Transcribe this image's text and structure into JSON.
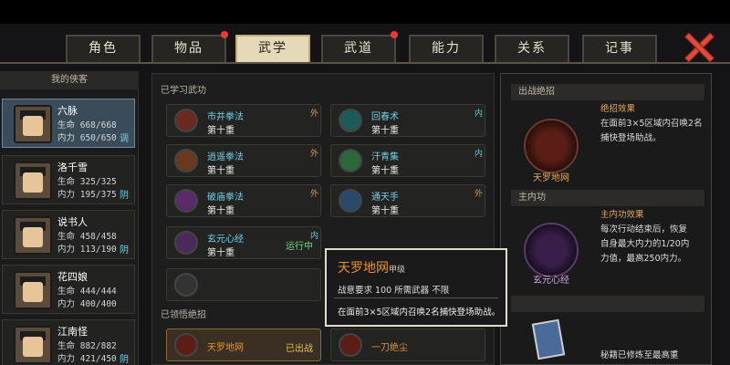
{
  "tabs": [
    {
      "label": "角色",
      "active": false,
      "dot": false
    },
    {
      "label": "物品",
      "active": false,
      "dot": true
    },
    {
      "label": "武学",
      "active": true,
      "dot": false
    },
    {
      "label": "武道",
      "active": false,
      "dot": true
    },
    {
      "label": "能力",
      "active": false,
      "dot": false
    },
    {
      "label": "关系",
      "active": false,
      "dot": false
    },
    {
      "label": "记事",
      "active": false,
      "dot": false
    }
  ],
  "left": {
    "title": "我的侠客",
    "characters": [
      {
        "name": "六脉",
        "hp": "生命 668/668",
        "mp": "内力 650/650",
        "tag": "调",
        "selected": true
      },
      {
        "name": "洛千雪",
        "hp": "生命 325/325",
        "mp": "内力 195/375",
        "tag": "阴",
        "selected": false
      },
      {
        "name": "说书人",
        "hp": "生命 458/458",
        "mp": "内力 113/190",
        "tag": "阴",
        "selected": false
      },
      {
        "name": "花四娘",
        "hp": "生命 444/444",
        "mp": "内力 400/400",
        "tag": "",
        "selected": false
      },
      {
        "name": "江南怪",
        "hp": "生命 882/882",
        "mp": "内力 421/450",
        "tag": "阴",
        "selected": false
      }
    ]
  },
  "middle": {
    "learned_title": "已学习武功",
    "skills": [
      {
        "name": "市井拳法",
        "level": "第十重",
        "corner": "外",
        "running": ""
      },
      {
        "name": "回春术",
        "level": "第十重",
        "corner": "内",
        "running": ""
      },
      {
        "name": "逍遥拳法",
        "level": "第十重",
        "corner": "外",
        "running": ""
      },
      {
        "name": "汗青集",
        "level": "第十重",
        "corner": "内",
        "running": ""
      },
      {
        "name": "破庙拳法",
        "level": "第十重",
        "corner": "外",
        "running": ""
      },
      {
        "name": "通天手",
        "level": "第十重",
        "corner": "外",
        "running": ""
      },
      {
        "name": "玄元心经",
        "level": "第十重",
        "corner": "内",
        "running": "运行中"
      }
    ],
    "ultimate_title": "已领悟绝招",
    "ultimates": [
      {
        "name": "天罗地网",
        "status": "已出战"
      },
      {
        "name": "一刀绝尘",
        "status": ""
      }
    ]
  },
  "tooltip": {
    "title": "天罗地网",
    "level": "甲级",
    "requirement": "战意要求  100     所需武器  不限",
    "description": "在面前3×5区域内召唤2名捕快登场助战。"
  },
  "right": {
    "battle_header": "出战绝招",
    "effect_title": "绝招效果",
    "effect_lines": [
      "在面前3×5区域内召唤2名",
      "捕快登场助战。"
    ],
    "battle_name": "天罗地网",
    "internal_header": "主内功",
    "internal_effect_title": "主内功效果",
    "internal_lines": [
      "每次行动结束后，恢复",
      "自身最大内力的1/20内",
      "力值，最高250内力。"
    ],
    "internal_name": "玄元心经",
    "bottom_text": "秘籍已修炼至最高重"
  }
}
